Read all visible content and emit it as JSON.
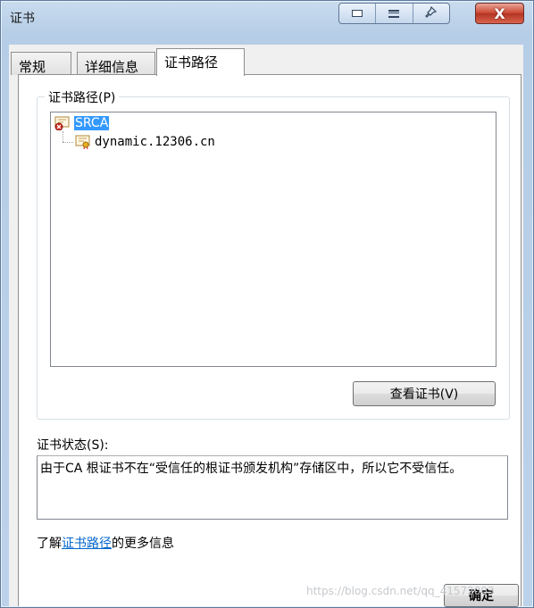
{
  "window": {
    "title": "证书"
  },
  "caption": {
    "close_label": "X"
  },
  "tabs": [
    {
      "label": "常规"
    },
    {
      "label": "详细信息"
    },
    {
      "label": "证书路径"
    }
  ],
  "path_group": {
    "legend": "证书路径(P)",
    "root_node": "SRCA",
    "child_node": "dynamic.12306.cn",
    "view_button": "查看证书(V)"
  },
  "status": {
    "label": "证书状态(S):",
    "text": "由于CA 根证书不在“受信任的根证书颁发机构”存储区中，所以它不受信任。"
  },
  "learn_more": {
    "prefix": "了解",
    "link": "证书路径",
    "suffix": "的更多信息"
  },
  "ok_button": "确定",
  "watermark": "https://blog.csdn.net/qq_41572003",
  "colors": {
    "selection": "#3399ff",
    "link": "#0066cc",
    "close_button": "#c9442f"
  }
}
